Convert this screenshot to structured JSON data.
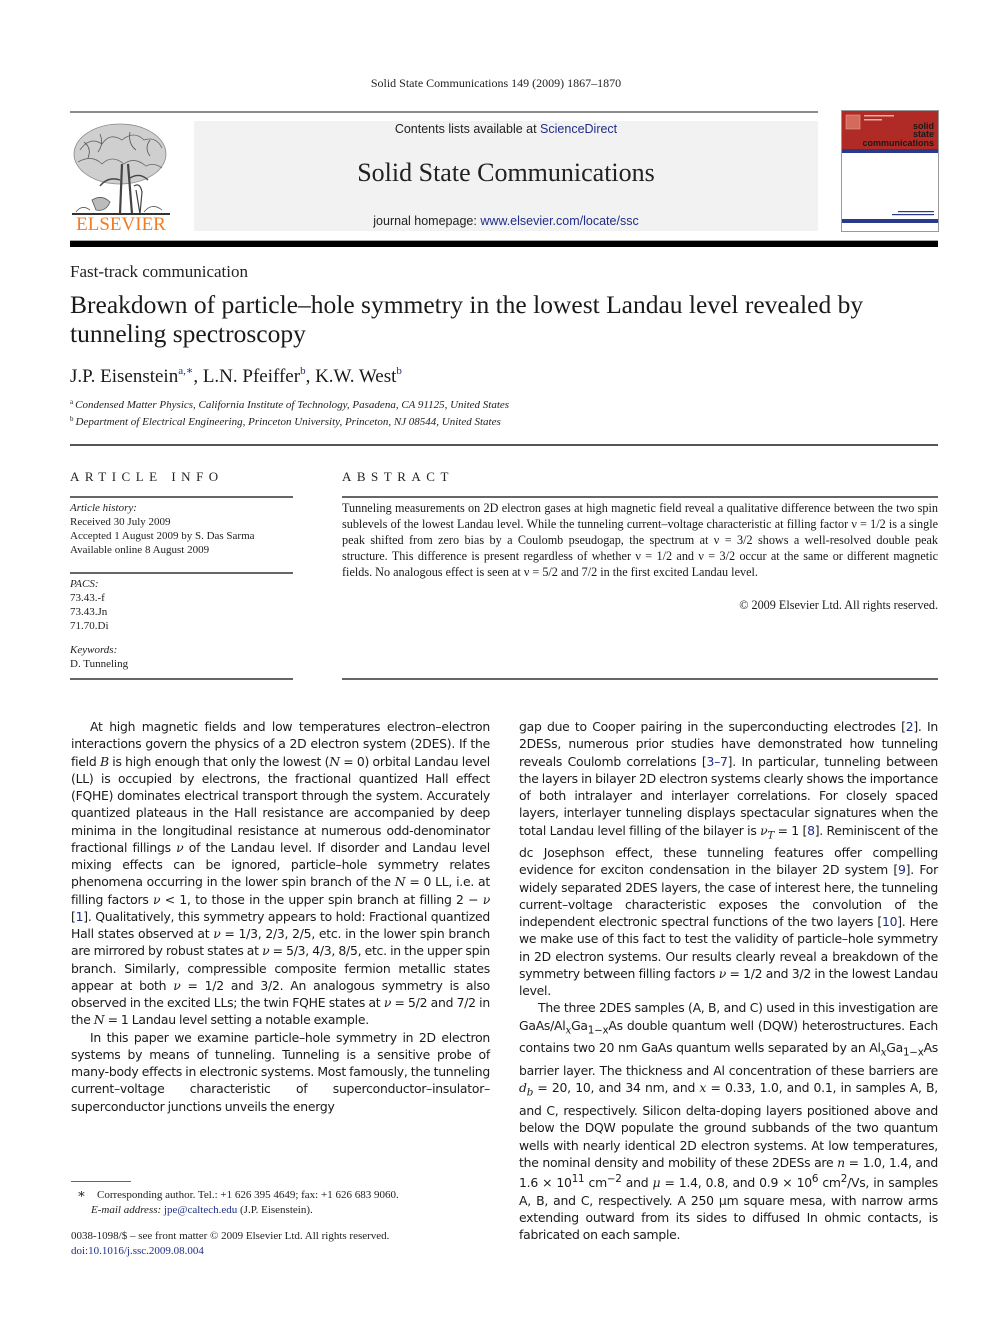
{
  "running_head": "Solid State Communications 149 (2009) 1867–1870",
  "header": {
    "publisher_logo_text": "ELSEVIER",
    "publisher_logo_color": "#f47b20",
    "contents_prefix": "Contents lists available at ",
    "contents_link": "ScienceDirect",
    "journal_name": "Solid State Communications",
    "homepage_prefix": "journal homepage: ",
    "homepage_link": "www.elsevier.com/locate/ssc",
    "cover": {
      "title_lines": [
        "solid",
        "state",
        "communications"
      ],
      "accent_color": "#b02a26",
      "band_color": "#2a3a8a"
    }
  },
  "article": {
    "section_label": "Fast-track communication",
    "title": "Breakdown of particle–hole symmetry in the lowest Landau level revealed by tunneling spectroscopy",
    "authors": [
      {
        "name": "J.P. Eisenstein",
        "marks": "a,∗"
      },
      {
        "name": "L.N. Pfeiffer",
        "marks": "b"
      },
      {
        "name": "K.W. West",
        "marks": "b"
      }
    ],
    "affiliations": [
      {
        "mark": "a",
        "text": "Condensed Matter Physics, California Institute of Technology, Pasadena, CA 91125, United States"
      },
      {
        "mark": "b",
        "text": "Department of Electrical Engineering, Princeton University, Princeton, NJ 08544, United States"
      }
    ]
  },
  "article_info": {
    "heading": "ARTICLE INFO",
    "history_label": "Article history:",
    "history": [
      "Received 30 July 2009",
      "Accepted 1 August 2009 by S. Das Sarma",
      "Available online 8 August 2009"
    ],
    "pacs_label": "PACS:",
    "pacs": [
      "73.43.-f",
      "73.43.Jn",
      "71.70.Di"
    ],
    "keywords_label": "Keywords:",
    "keywords": [
      "D. Tunneling"
    ]
  },
  "abstract": {
    "heading": "ABSTRACT",
    "text": "Tunneling measurements on 2D electron gases at high magnetic field reveal a qualitative difference between the two spin sublevels of the lowest Landau level. While the tunneling current–voltage characteristic at filling factor ν = 1/2 is a single peak shifted from zero bias by a Coulomb pseudogap, the spectrum at ν = 3/2 shows a well-resolved double peak structure. This difference is present regardless of whether ν = 1/2 and ν = 3/2 occur at the same or different magnetic fields. No analogous effect is seen at ν = 5/2 and 7/2 in the first excited Landau level.",
    "copyright": "© 2009 Elsevier Ltd. All rights reserved."
  },
  "body": {
    "left_p1": [
      "At high magnetic fields and low temperatures electron–electron interactions govern the physics of a 2D electron system (2DES). If the field ",
      "B",
      " is high enough that only the lowest (",
      "N",
      " = 0) orbital Landau level (LL) is occupied by electrons, the fractional quantized Hall effect (FQHE) dominates electrical transport through the system. Accurately quantized plateaus in the Hall resistance are accompanied by deep minima in the longitudinal resistance at numerous odd-denominator fractional fillings ",
      "ν",
      " of the Landau level. If disorder and Landau level mixing effects can be ignored, particle–hole symmetry relates phenomena occurring in the lower spin branch of the ",
      "N",
      " = 0 LL, i.e. at filling factors ",
      "ν",
      " < 1, to those in the upper spin branch at filling 2 − ",
      "ν",
      " [",
      "1",
      "]. Qualitatively, this symmetry appears to hold: Fractional quantized Hall states observed at ",
      "ν",
      " = 1/3, 2/3, 2/5, etc. in the lower spin branch are mirrored by robust states at ",
      "ν",
      " = 5/3, 4/3, 8/5, etc. in the upper spin branch. Similarly, compressible composite fermion metallic states appear at both ",
      "ν",
      " = 1/2 and 3/2. An analogous symmetry is also observed in the excited LLs; the twin FQHE states at ",
      "ν",
      " = 5/2 and 7/2 in the ",
      "N",
      " = 1 Landau level setting a notable example."
    ],
    "left_p2": "In this paper we examine particle–hole symmetry in 2D electron systems by means of tunneling. Tunneling is a sensitive probe of many-body effects in electronic systems. Most famously, the tunneling current–voltage characteristic of superconductor–insulator–superconductor junctions unveils the energy",
    "right_p1": [
      "gap due to Cooper pairing in the superconducting electrodes [",
      "2",
      "]. In 2DESs, numerous prior studies have demonstrated how tunneling reveals Coulomb correlations [",
      "3–7",
      "]. In particular, tunneling between the layers in bilayer 2D electron systems clearly shows the importance of both intralayer and interlayer correlations. For closely spaced layers, interlayer tunneling displays spectacular signatures when the total Landau level filling of the bilayer is ",
      "ν",
      "T",
      " = 1 [",
      "8",
      "]. Reminiscent of the dc Josephson effect, these tunneling features offer compelling evidence for exciton condensation in the bilayer 2D system [",
      "9",
      "]. For widely separated 2DES layers, the case of interest here, the tunneling current–voltage characteristic exposes the convolution of the independent electronic spectral functions of the two layers [",
      "10",
      "]. Here we make use of this fact to test the validity of particle–hole symmetry in 2D electron systems. Our results clearly reveal a breakdown of the symmetry between filling factors ",
      "ν",
      " = 1/2 and 3/2 in the lowest Landau level."
    ],
    "right_p2": [
      "The three 2DES samples (A, B, and C) used in this investigation are GaAs/Al",
      "x",
      "Ga",
      "1−x",
      "As double quantum well (DQW) heterostructures. Each contains two 20 nm GaAs quantum wells separated by an Al",
      "x",
      "Ga",
      "1−x",
      "As barrier layer. The thickness and Al concentration of these barriers are ",
      "d",
      "b",
      " = 20, 10, and 34 nm, and ",
      "x",
      " = 0.33, 1.0, and 0.1, in samples A, B, and C, respectively. Silicon delta-doping layers positioned above and below the DQW populate the ground subbands of the two quantum wells with nearly identical 2D electron systems. At low temperatures, the nominal density and mobility of these 2DESs are ",
      "n",
      " = 1.0, 1.4, and 1.6 × 10",
      "11",
      " cm",
      "−2",
      " and ",
      "μ",
      " = 1.4, 0.8, and 0.9 × 10",
      "6",
      " cm",
      "2",
      "/Vs, in samples A, B, and C, respectively. A 250 μm square mesa, with narrow arms extending outward from its sides to diffused In ohmic contacts, is fabricated on each sample."
    ]
  },
  "footnotes": {
    "star": "∗",
    "corresponding": "Corresponding author. Tel.: +1 626 395 4649; fax: +1 626 683 9060.",
    "email_label": "E-mail address:",
    "email": "jpe@caltech.edu",
    "email_suffix": " (J.P. Eisenstein).",
    "front_matter": "0038-1098/$ – see front matter © 2009 Elsevier Ltd. All rights reserved.",
    "doi": "doi:10.1016/j.ssc.2009.08.004"
  }
}
